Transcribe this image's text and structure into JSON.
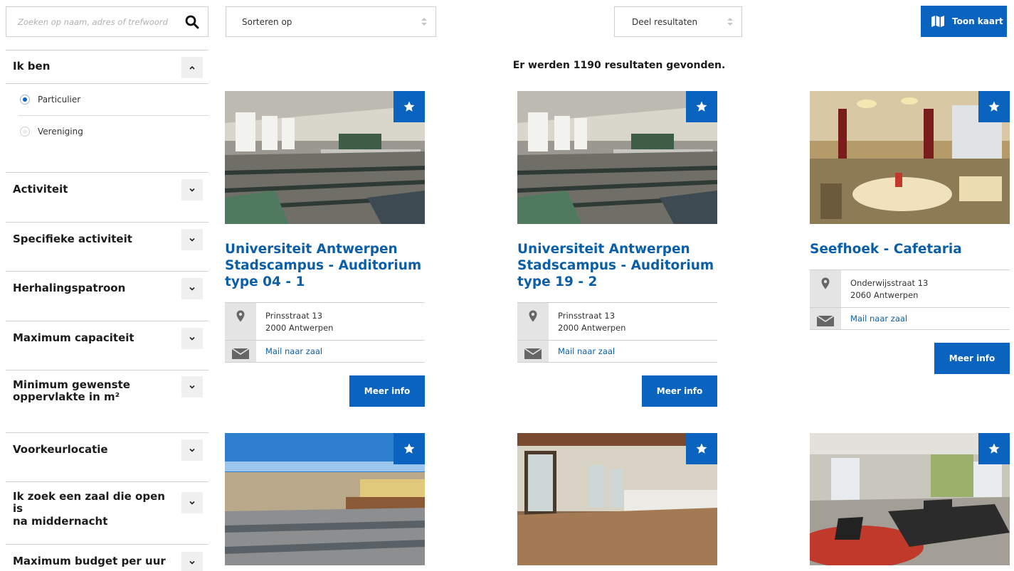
{
  "search": {
    "placeholder": "Zoeken op naam, adres of trefwoord"
  },
  "sort": {
    "label": "Sorteren op"
  },
  "share": {
    "label": "Deel resultaten"
  },
  "map_button": {
    "label": "Toon kaart"
  },
  "results_text": "Er werden 1190 resultaten gevonden.",
  "filters": {
    "ik_ben": {
      "label": "Ik ben",
      "options": [
        "Particulier",
        "Vereniging"
      ],
      "selected": "Particulier"
    },
    "activiteit": "Activiteit",
    "specifieke_activiteit": "Specifieke activiteit",
    "herhalingspatroon": "Herhalingspatroon",
    "maximum_capaciteit": "Maximum capaciteit",
    "minimum_oppervlakte_line1": "Minimum gewenste",
    "minimum_oppervlakte_line2": "oppervlakte in m²",
    "voorkeurlocatie": "Voorkeurlocatie",
    "open_na_middernacht_line1": "Ik zoek een zaal die open is",
    "open_na_middernacht_line2": "na middernacht",
    "maximum_budget": "Maximum budget per uur"
  },
  "cards": [
    {
      "title_line1": "Universiteit Antwerpen",
      "title_line2": "Stadscampus - Auditorium",
      "title_line3": "type 04 - 1",
      "street": "Prinsstraat 13",
      "city": "2000 Antwerpen",
      "mail": "Mail naar zaal",
      "more": "Meer info"
    },
    {
      "title_line1": "Universiteit Antwerpen",
      "title_line2": "Stadscampus - Auditorium",
      "title_line3": "type 19 - 2",
      "street": "Prinsstraat 13",
      "city": "2000 Antwerpen",
      "mail": "Mail naar zaal",
      "more": "Meer info"
    },
    {
      "title_line1": "Seefhoek - Cafetaria",
      "street": "Onderwijsstraat 13",
      "city": "2060 Antwerpen",
      "mail": "Mail naar zaal",
      "more": "Meer info"
    }
  ],
  "colors": {
    "accent": "#0b63c0",
    "title": "#0b5ea8",
    "icon_bg": "#e4e4e4"
  },
  "icons": [
    "search-icon",
    "map-icon",
    "chevron-up-icon",
    "chevron-down-icon",
    "star-icon",
    "location-pin-icon",
    "envelope-icon"
  ]
}
